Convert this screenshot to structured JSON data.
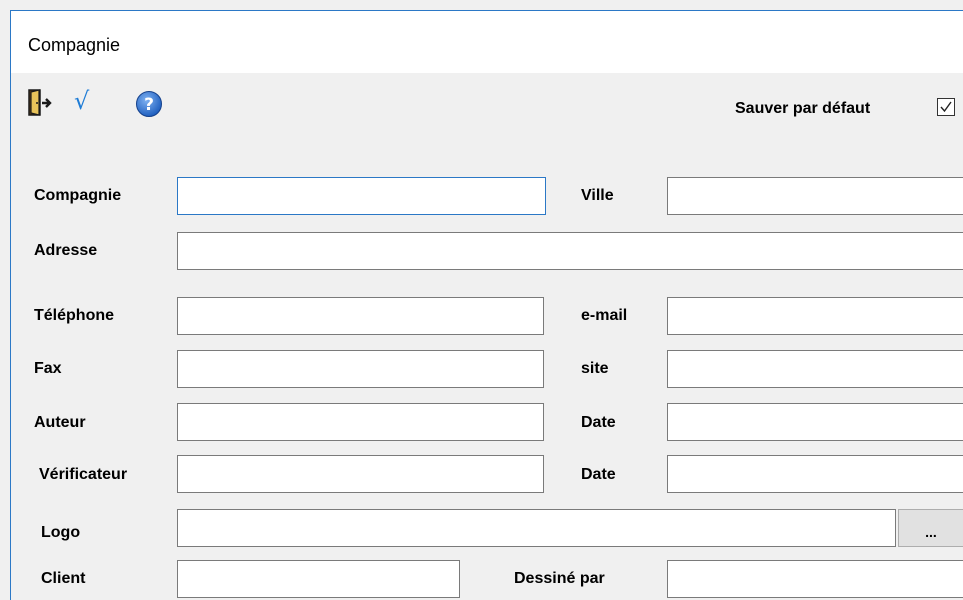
{
  "window": {
    "title": "Compagnie"
  },
  "toolbar": {
    "exit_icon": "exit-door-icon",
    "validate_icon": "check-root-icon",
    "validate_symbol": "√",
    "help_icon": "help-icon",
    "save_default_label": "Sauver par défaut",
    "save_default_checked": true
  },
  "form": {
    "compagnie_label": "Compagnie",
    "compagnie_value": "",
    "ville_label": "Ville",
    "ville_value": "",
    "adresse_label": "Adresse",
    "adresse_value": "",
    "telephone_label": "Téléphone",
    "telephone_value": "",
    "email_label": "e-mail",
    "email_value": "",
    "fax_label": "Fax",
    "fax_value": "",
    "site_label": "site",
    "site_value": "",
    "auteur_label": "Auteur",
    "auteur_value": "",
    "auteur_date_label": "Date",
    "auteur_date_value": "",
    "verificateur_label": "Vérificateur",
    "verificateur_value": "",
    "verificateur_date_label": "Date",
    "verificateur_date_value": "",
    "logo_label": "Logo",
    "logo_value": "",
    "logo_browse_label": "...",
    "client_label": "Client",
    "client_value": "",
    "dessine_par_label": "Dessiné par",
    "dessine_par_value": ""
  },
  "colors": {
    "accent": "#2b78c6",
    "window_bg": "#f0f0f0",
    "titlebar_bg": "#ffffff",
    "help_blue": "#1f5fbf"
  }
}
